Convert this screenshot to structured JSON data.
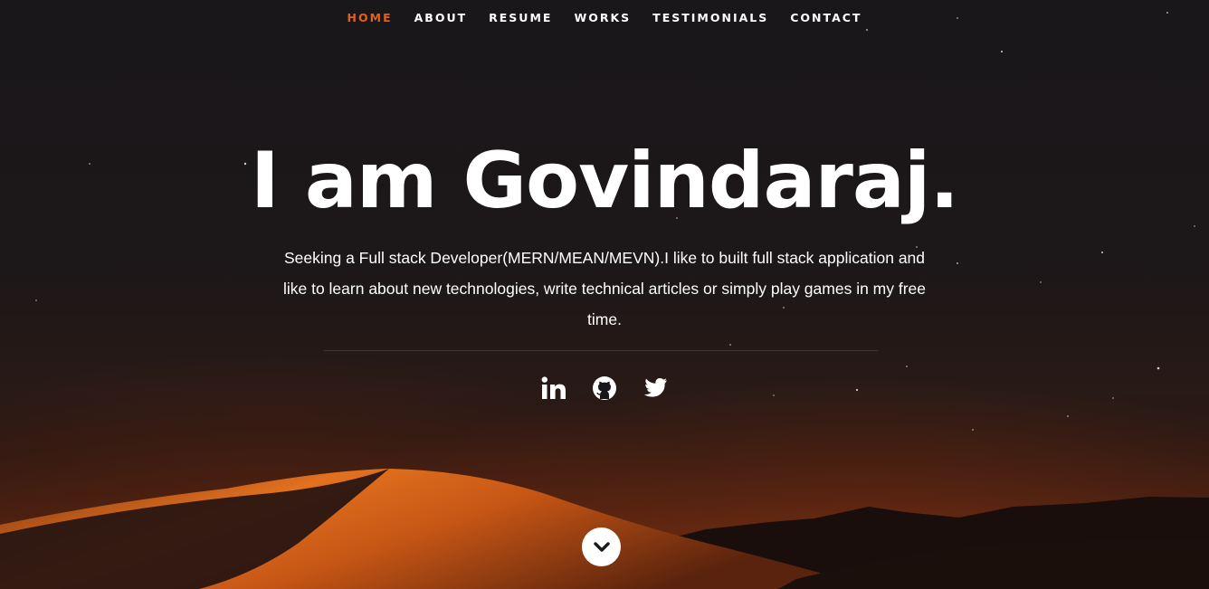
{
  "nav": {
    "items": [
      {
        "label": "HOME",
        "active": true
      },
      {
        "label": "ABOUT",
        "active": false
      },
      {
        "label": "RESUME",
        "active": false
      },
      {
        "label": "WORKS",
        "active": false
      },
      {
        "label": "TESTIMONIALS",
        "active": false
      },
      {
        "label": "CONTACT",
        "active": false
      }
    ],
    "active_color": "#e3601c"
  },
  "hero": {
    "title": "I am Govindaraj.",
    "description": "Seeking a Full stack Developer(MERN/MEAN/MEVN).I like to built full stack application and like to learn about new technologies, write technical articles or simply play games in my free time."
  },
  "social": [
    {
      "icon": "linkedin-icon"
    },
    {
      "icon": "github-icon"
    },
    {
      "icon": "twitter-icon"
    }
  ],
  "scroll_button": {
    "icon": "chevron-down-icon"
  },
  "colors": {
    "background": "#19161a",
    "dune": "#d8621c",
    "text": "#ffffff"
  }
}
